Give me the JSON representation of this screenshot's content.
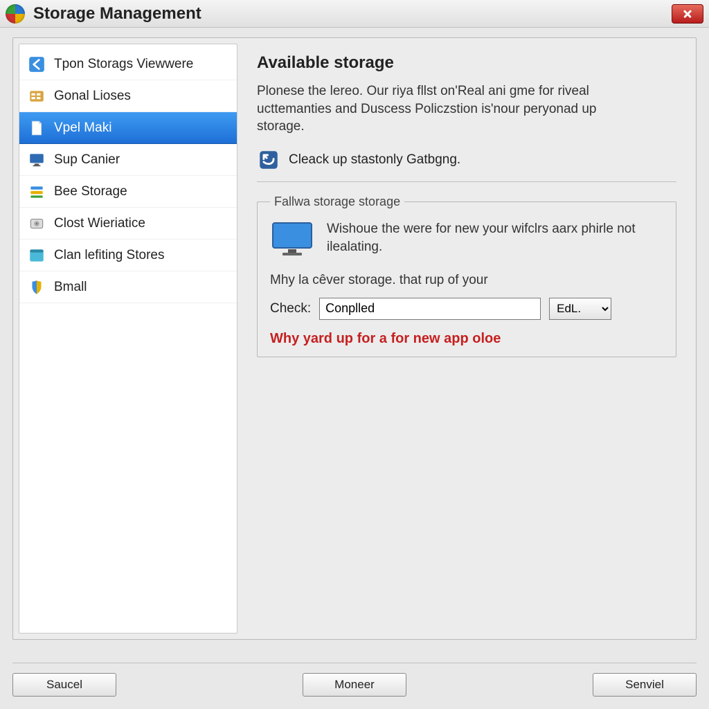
{
  "window": {
    "title": "Storage Management"
  },
  "sidebar": {
    "items": [
      {
        "label": "Tpon Storags Viewwere",
        "icon": "back-arrow-icon"
      },
      {
        "label": "Gonal Lioses",
        "icon": "folder-grid-icon"
      },
      {
        "label": "Vpel Maki",
        "icon": "document-icon",
        "selected": true
      },
      {
        "label": "Sup Canier",
        "icon": "monitor-small-icon"
      },
      {
        "label": "Bee Storage",
        "icon": "stack-icon"
      },
      {
        "label": "Clost Wieriatice",
        "icon": "drive-icon"
      },
      {
        "label": "Clan lefiting Stores",
        "icon": "window-icon"
      },
      {
        "label": "Bmall",
        "icon": "shield-icon"
      }
    ]
  },
  "main": {
    "heading": "Available storage",
    "description": "Plonese the lereo. Our riya fllst on'Real ani gme for riveal ucttemanties and Duscess Policzstion is'nour peryonad up storage.",
    "cleanup_label": "Cleack up stastonly Gatbgng.",
    "group": {
      "legend": "Fallwa storage storage",
      "monitor_text": "Wishoue the were for new your wifclrs aarx phirle not ilealating.",
      "subtext": "Mhy la cêver storage. that rup of your",
      "check_label": "Check:",
      "check_value": "Conplled",
      "dropdown_value": "EdL.",
      "warning": "Why yard up for a for new app oloe"
    }
  },
  "footer": {
    "left": "Saucel",
    "center": "Moneer",
    "right": "Senviel"
  },
  "colors": {
    "accent": "#1e6fd6",
    "warning": "#c62020"
  }
}
